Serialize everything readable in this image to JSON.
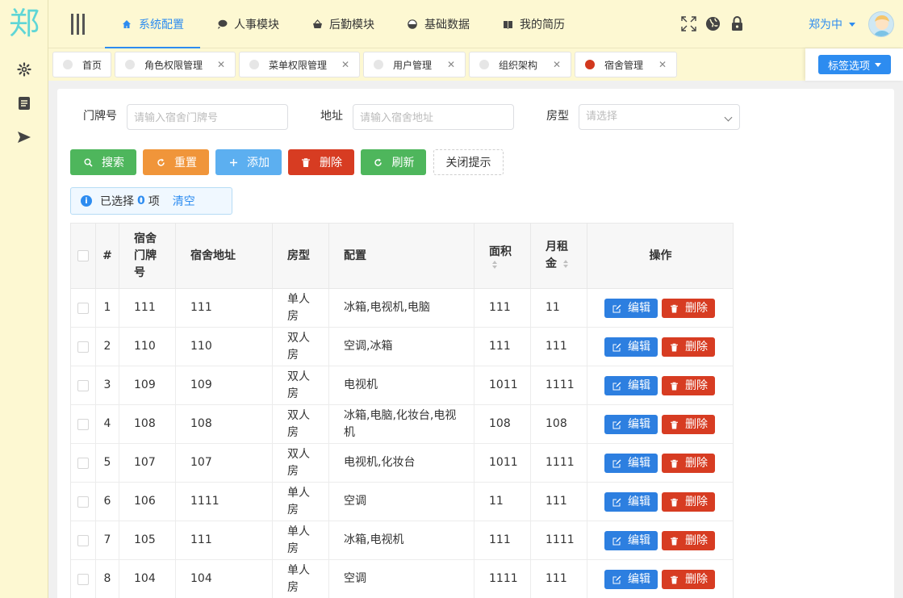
{
  "logo": "郑",
  "nav": [
    {
      "label": "系统配置",
      "icon": "home-icon",
      "active": true
    },
    {
      "label": "人事模块",
      "icon": "chat-icon",
      "active": false
    },
    {
      "label": "后勤模块",
      "icon": "basket-icon",
      "active": false
    },
    {
      "label": "基础数据",
      "icon": "yin-yang-icon",
      "active": false
    },
    {
      "label": "我的简历",
      "icon": "book-icon",
      "active": false
    }
  ],
  "user": {
    "name": "郑为中"
  },
  "tags": [
    {
      "label": "首页",
      "closable": false,
      "active": false
    },
    {
      "label": "角色权限管理",
      "closable": true,
      "active": false
    },
    {
      "label": "菜单权限管理",
      "closable": true,
      "active": false
    },
    {
      "label": "用户管理",
      "closable": true,
      "active": false
    },
    {
      "label": "组织架构",
      "closable": true,
      "active": false
    },
    {
      "label": "宿舍管理",
      "closable": true,
      "active": true
    }
  ],
  "tag_close": "✕",
  "tag_options": "标签选项",
  "filters": {
    "door_label": "门牌号",
    "door_placeholder": "请输入宿舍门牌号",
    "address_label": "地址",
    "address_placeholder": "请输入宿舍地址",
    "room_label": "房型",
    "room_placeholder": "请选择"
  },
  "buttons": {
    "search": "搜索",
    "reset": "重置",
    "add": "添加",
    "delete": "删除",
    "refresh": "刷新",
    "close_tip": "关闭提示"
  },
  "selection": {
    "prefix": "已选择",
    "count": "0",
    "suffix": "项",
    "clear": "清空"
  },
  "table": {
    "headers": {
      "index": "#",
      "door": "宿舍门牌号",
      "address": "宿舍地址",
      "room_type": "房型",
      "config": "配置",
      "area": "面积",
      "rent": "月租金",
      "actions": "操作"
    },
    "edit_label": "编辑",
    "delete_label": "删除",
    "rows": [
      {
        "index": "1",
        "door": "111",
        "address": "111",
        "room_type": "单人房",
        "config": "冰箱,电视机,电脑",
        "area": "111",
        "rent": "11"
      },
      {
        "index": "2",
        "door": "110",
        "address": "110",
        "room_type": "双人房",
        "config": "空调,冰箱",
        "area": "111",
        "rent": "111"
      },
      {
        "index": "3",
        "door": "109",
        "address": "109",
        "room_type": "双人房",
        "config": "电视机",
        "area": "1011",
        "rent": "1111"
      },
      {
        "index": "4",
        "door": "108",
        "address": "108",
        "room_type": "双人房",
        "config": "冰箱,电脑,化妆台,电视机",
        "area": "108",
        "rent": "108"
      },
      {
        "index": "5",
        "door": "107",
        "address": "107",
        "room_type": "双人房",
        "config": "电视机,化妆台",
        "area": "1011",
        "rent": "1111"
      },
      {
        "index": "6",
        "door": "106",
        "address": "1111",
        "room_type": "单人房",
        "config": "空调",
        "area": "11",
        "rent": "111"
      },
      {
        "index": "7",
        "door": "105",
        "address": "111",
        "room_type": "单人房",
        "config": "冰箱,电视机",
        "area": "111",
        "rent": "1111"
      },
      {
        "index": "8",
        "door": "104",
        "address": "104",
        "room_type": "单人房",
        "config": "空调",
        "area": "1111",
        "rent": "111"
      }
    ]
  }
}
